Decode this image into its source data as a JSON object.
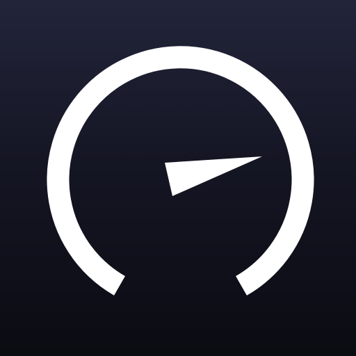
{
  "icon": {
    "name": "speedometer-icon",
    "colors": {
      "background_top": "#22243a",
      "background_bottom": "#0b0b12",
      "glyph": "#ffffff"
    }
  }
}
